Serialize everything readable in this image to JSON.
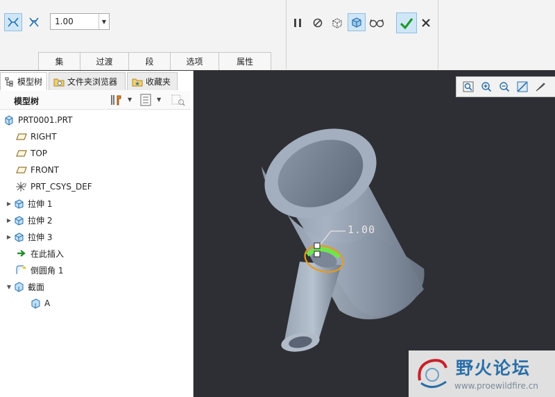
{
  "toolbar": {
    "value": "1.00",
    "tabs": [
      "集",
      "过渡",
      "段",
      "选项",
      "属性"
    ],
    "icons": [
      "round-set-icon",
      "round-transition-icon",
      "pause-icon",
      "no-preview-icon",
      "preview-geometry-icon",
      "verify-icon",
      "glasses-icon",
      "ok-check-icon",
      "cancel-x-icon"
    ]
  },
  "panel": {
    "tabs": [
      "模型树",
      "文件夹浏览器",
      "收藏夹"
    ],
    "header": "模型树"
  },
  "tree": [
    {
      "label": "PRT0001.PRT",
      "icon": "part-icon",
      "expandable": false
    },
    {
      "label": "RIGHT",
      "icon": "datum-plane-icon",
      "expandable": false
    },
    {
      "label": "TOP",
      "icon": "datum-plane-icon",
      "expandable": false
    },
    {
      "label": "FRONT",
      "icon": "datum-plane-icon",
      "expandable": false
    },
    {
      "label": "PRT_CSYS_DEF",
      "icon": "csys-icon",
      "expandable": false
    },
    {
      "label": "拉伸 1",
      "icon": "extrude-icon",
      "expandable": true
    },
    {
      "label": "拉伸 2",
      "icon": "extrude-icon",
      "expandable": true
    },
    {
      "label": "拉伸 3",
      "icon": "extrude-icon",
      "expandable": true
    },
    {
      "label": "在此插入",
      "icon": "insert-here-arrow-icon",
      "expandable": false
    },
    {
      "label": "倒圆角 1",
      "icon": "round-icon",
      "expandable": false
    },
    {
      "label": "截面",
      "icon": "section-icon",
      "expandable": true
    },
    {
      "label": "A",
      "icon": "section-icon",
      "expandable": false
    }
  ],
  "viewport": {
    "dimension_label": "1.00",
    "background": "#2e2f34",
    "model_color": "#9aa7b7"
  },
  "watermark": {
    "title": "野火论坛",
    "url": "www.proewildfire.cn"
  },
  "colors": {
    "accent": "#1e8fd6",
    "ok_green": "#1d9a2a",
    "highlight_green": "#6ee64a",
    "highlight_orange": "#e89b1a"
  }
}
